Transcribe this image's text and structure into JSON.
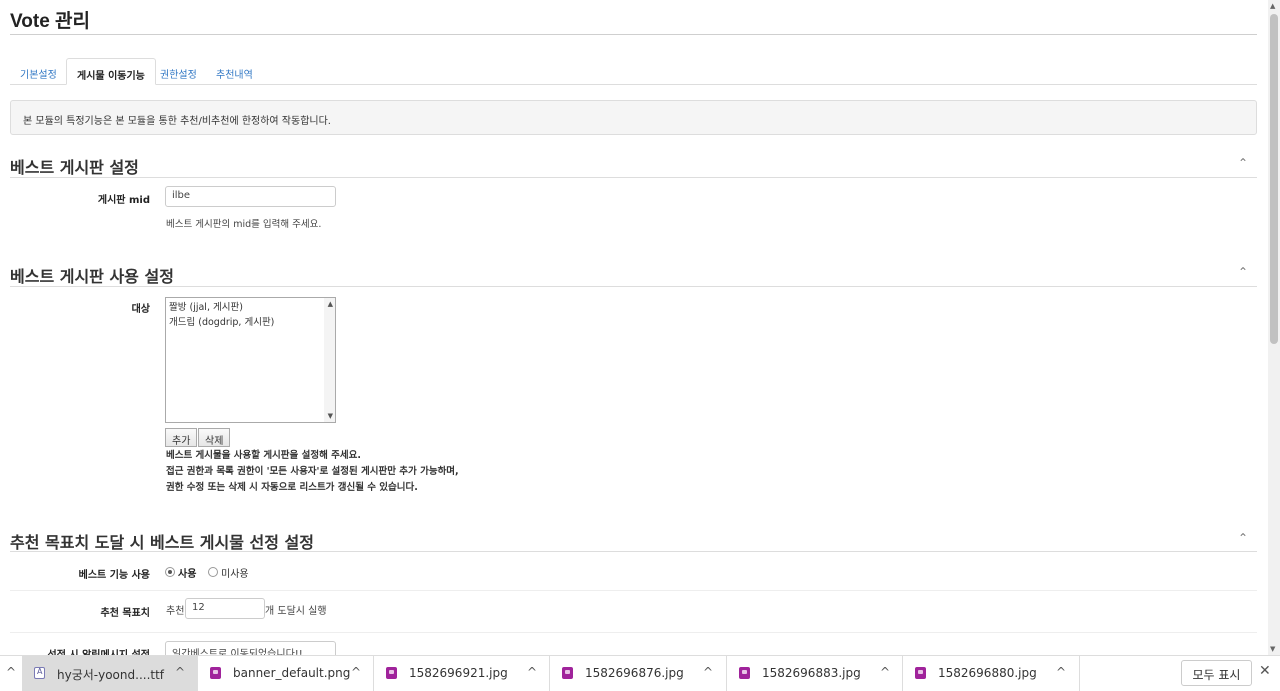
{
  "page": {
    "title": "Vote 관리"
  },
  "tabs": [
    {
      "label": "기본설정"
    },
    {
      "label": "게시물 이동기능"
    },
    {
      "label": "권한설정"
    },
    {
      "label": "추천내역"
    }
  ],
  "notice": "본 모듈의 특정기능은 본 모듈을 통한 추천/비추천에 한정하여 작동합니다.",
  "sections": {
    "best_board": {
      "title": "베스트 게시판 설정",
      "mid_label": "게시판 mid",
      "mid_value": "ilbe",
      "mid_help": "베스트 게시판의 mid를 입력해 주세요."
    },
    "best_usage": {
      "title": "베스트 게시판 사용 설정",
      "target_label": "대상",
      "target_options": [
        "짤방 (jjal, 게시판)",
        "개드립 (dogdrip, 게시판)"
      ],
      "add_label": "추가",
      "delete_label": "삭제",
      "help_lines": [
        "베스트 게시물을 사용할 게시판을 설정해 주세요.",
        "접근 권한과 목록 권한이 '모든 사용자'로 설정된 게시판만 추가 가능하며,",
        "권한 수정 또는 삭제 시 자동으로 리스트가 갱신될 수 있습니다."
      ]
    },
    "goal": {
      "title": "추천 목표치 도달 시 베스트 게시물 선정 설정",
      "use_label": "베스트 기능 사용",
      "use_on": "사용",
      "use_off": "미사용",
      "goal_label": "추천 목표치",
      "goal_prefix": "추천",
      "goal_value": "12",
      "goal_suffix": "개 도달시 실행",
      "alert_label": "선정 시 알림메시지 설정",
      "alert_value": "일간베스트로 이동되었습니다!!"
    }
  },
  "downloads": {
    "items": [
      {
        "name": "hy궁서-yoond....ttf",
        "icon": "font-file-icon"
      },
      {
        "name": "banner_default.png",
        "icon": "image-file-icon"
      },
      {
        "name": "1582696921.jpg",
        "icon": "image-file-icon"
      },
      {
        "name": "1582696876.jpg",
        "icon": "image-file-icon"
      },
      {
        "name": "1582696883.jpg",
        "icon": "image-file-icon"
      },
      {
        "name": "1582696880.jpg",
        "icon": "image-file-icon"
      }
    ],
    "show_all": "모두 표시",
    "close_glyph": "✕",
    "caret_glyph": "^"
  }
}
